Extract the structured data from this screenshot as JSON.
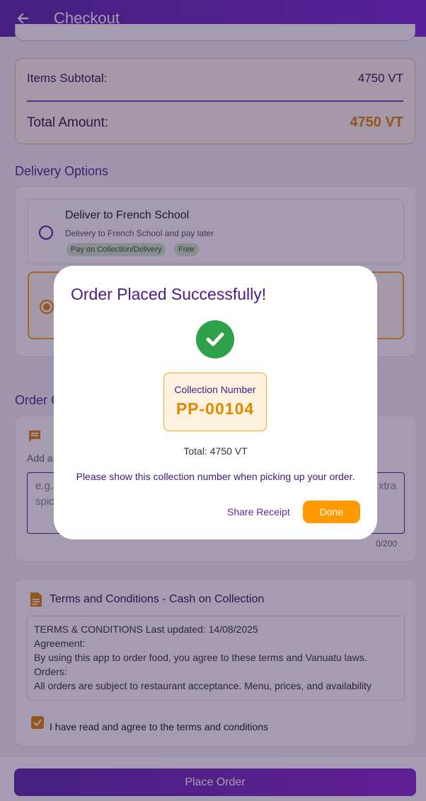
{
  "appbar": {
    "title": "Checkout"
  },
  "totals": {
    "subtotal_label": "Items Subtotal:",
    "subtotal_value": "4750 VT",
    "total_label": "Total Amount:",
    "total_value": "4750 VT"
  },
  "delivery": {
    "title": "Delivery Options",
    "options": [
      {
        "name": "Deliver to French School",
        "description": "Delivery to French School and pay later",
        "chips": [
          "Pay on Collection/Delivery",
          "Free"
        ],
        "selected": false
      },
      {
        "selected": true
      }
    ]
  },
  "notes": {
    "title_partial": "Order C",
    "helper_partial": "Add a",
    "text_left": "e.g.",
    "text_left2": "spic",
    "text_right": "xtra",
    "counter": "0/200"
  },
  "terms": {
    "title": "Terms and Conditions - Cash on Collection",
    "lines": [
      "TERMS & CONDITIONS Last updated: 14/08/2025",
      "Agreement:",
      "By using this app to order food, you agree to these terms and Vanuatu laws.",
      "Orders:",
      "All orders are subject to restaurant acceptance. Menu, prices, and availability"
    ],
    "agree_label": "I have read and agree to the terms and conditions",
    "agreed": true
  },
  "place_order": {
    "label": "Place Order"
  },
  "dialog": {
    "title": "Order Placed Successfully!",
    "collection_label": "Collection Number",
    "collection_number": "PP-00104",
    "total_text": "Total: 4750 VT",
    "message": "Please show this collection number when picking up your order.",
    "share_label": "Share Receipt",
    "done_label": "Done"
  },
  "colors": {
    "primary": "#5a2aa8",
    "accent": "#ff9a00",
    "success": "#2ea04a"
  }
}
